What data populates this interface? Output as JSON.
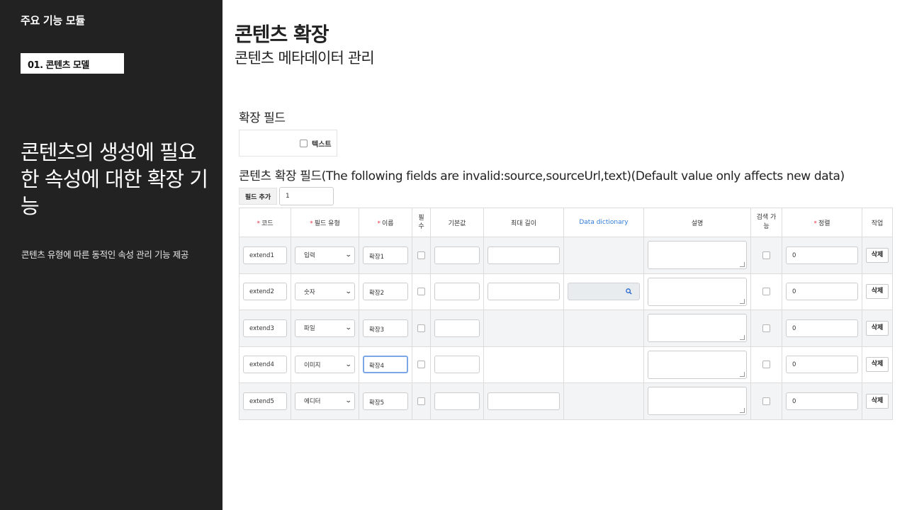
{
  "sidebar": {
    "section_title": "주요 기능 모듈",
    "module_badge": "01. 콘텐츠 모델",
    "headline": "콘텐츠의 생성에 필요한 속성에 대한 확장 기능",
    "description": "콘텐츠 유형에 따른 동적인 속성 관리 기능 제공"
  },
  "header": {
    "title": "콘텐츠 확장",
    "subtitle": "콘텐츠 메타데이터 관리"
  },
  "extension_fields": {
    "label": "확장 필드",
    "checkbox_label": "텍스트"
  },
  "fields_section": {
    "title": "콘텐츠 확장 필드(The following fields are invalid:source,sourceUrl,text)(Default value only affects new data)",
    "add_button_label": "필드 추가",
    "add_count": "1"
  },
  "table": {
    "headers": {
      "code": "코드",
      "field_type": "필드 유형",
      "name": "이름",
      "required": "필수",
      "default": "기본값",
      "max_length": "최대 길이",
      "data_dictionary": "Data dictionary",
      "description": "설명",
      "searchable": "검색 가능",
      "sort": "정렬",
      "action": "작업"
    },
    "rows": [
      {
        "code": "extend1",
        "type": "입력",
        "name": "확장1",
        "sort": "0",
        "delete": "삭제"
      },
      {
        "code": "extend2",
        "type": "숫자",
        "name": "확장2",
        "sort": "0",
        "delete": "삭제"
      },
      {
        "code": "extend3",
        "type": "파일",
        "name": "확장3",
        "sort": "0",
        "delete": "삭제"
      },
      {
        "code": "extend4",
        "type": "이미지",
        "name": "확장4",
        "sort": "0",
        "delete": "삭제"
      },
      {
        "code": "extend5",
        "type": "에디터",
        "name": "확장5",
        "sort": "0",
        "delete": "삭제"
      }
    ]
  },
  "colors": {
    "sidebar_bg": "#222222",
    "required_mark": "#e8374f",
    "link_blue": "#2f7bd8"
  }
}
